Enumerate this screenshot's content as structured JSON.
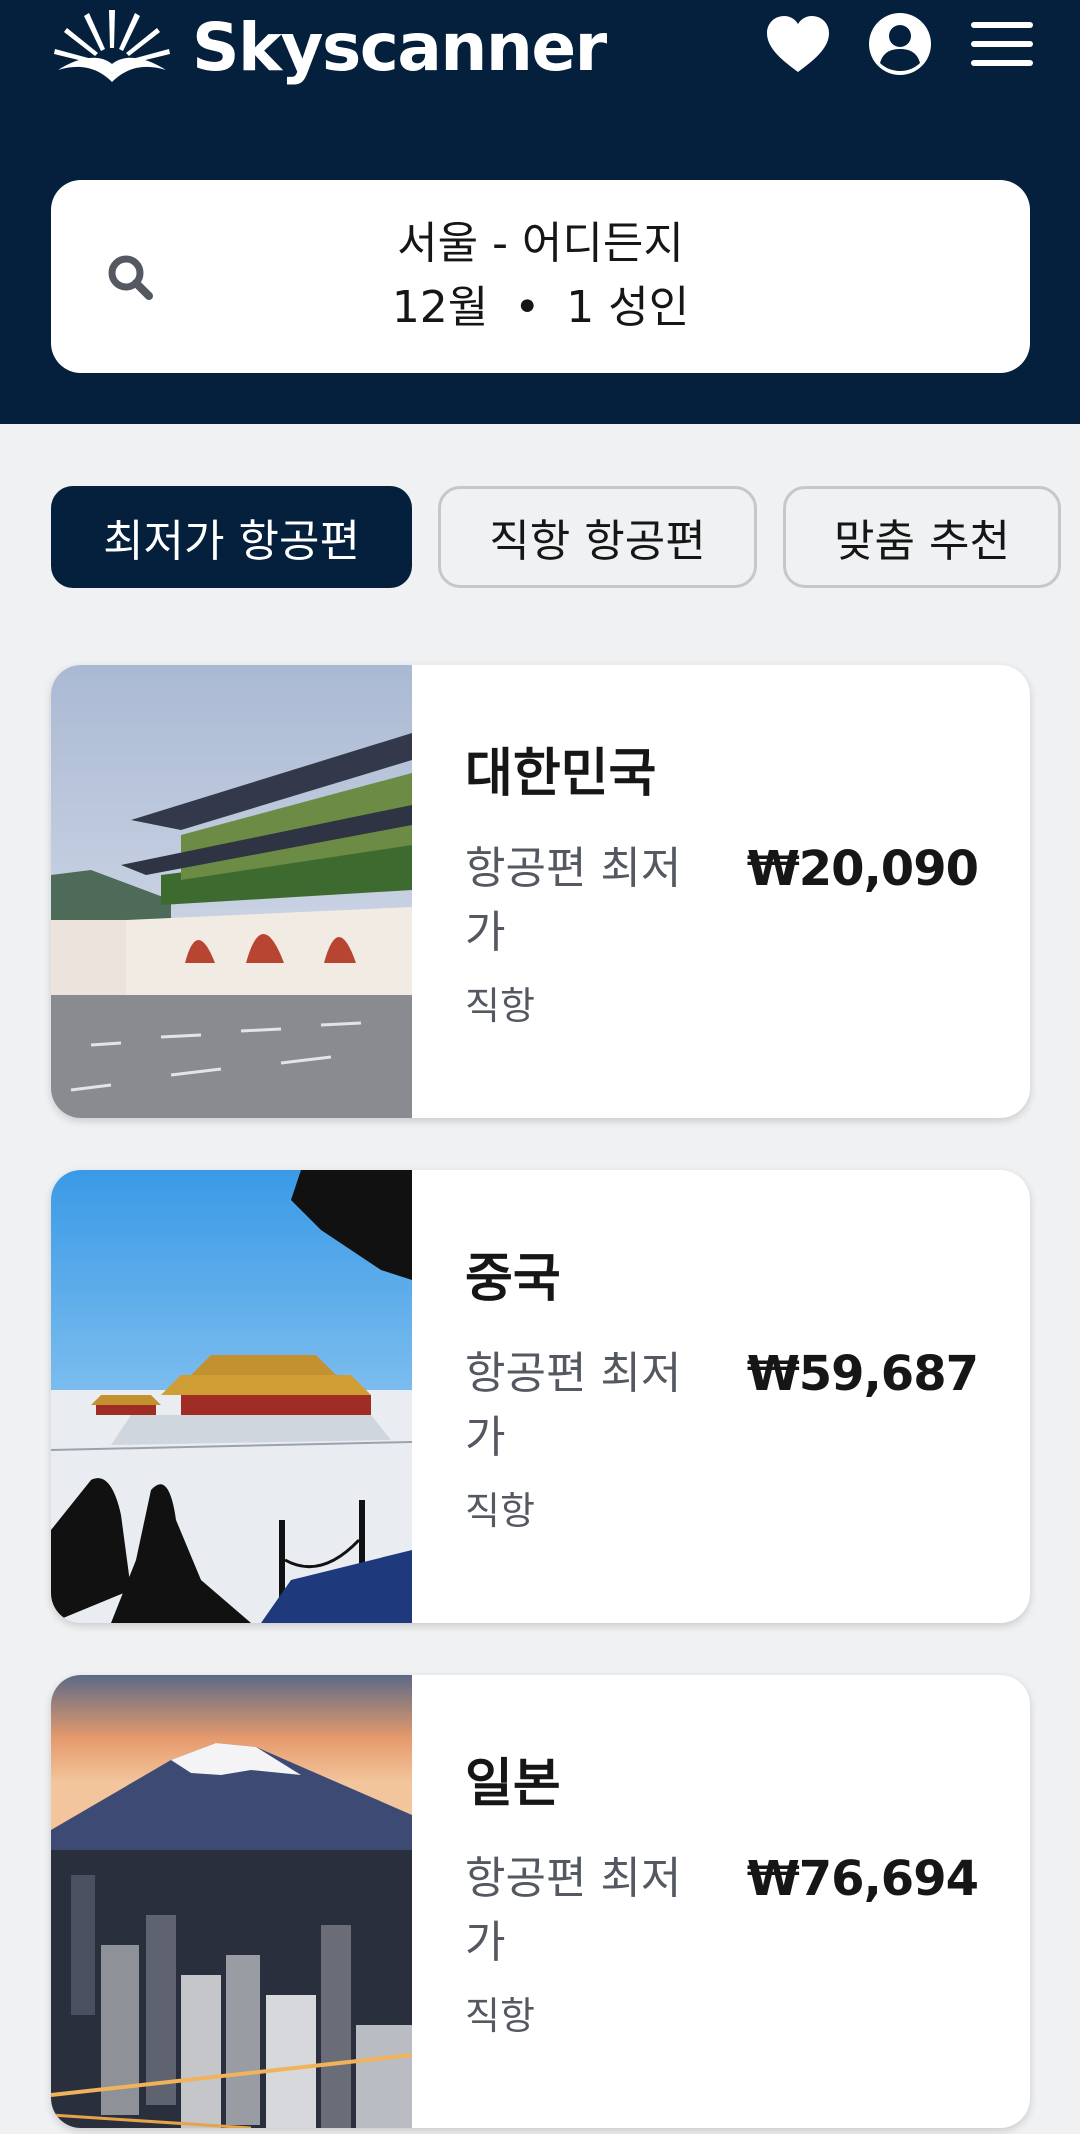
{
  "header": {
    "brand": "Skyscanner",
    "icons": [
      "heart-icon",
      "account-icon",
      "menu-icon"
    ],
    "colors": {
      "background": "#05203c",
      "text": "#ffffff"
    }
  },
  "search": {
    "route": "서울 - 어디든지",
    "month": "12월",
    "separator": "•",
    "passengers": "1 성인"
  },
  "filters": [
    {
      "label": "최저가 항공편",
      "selected": true
    },
    {
      "label": "직항 항공편",
      "selected": false
    },
    {
      "label": "맞춤 추천",
      "selected": false
    }
  ],
  "destinations": [
    {
      "country": "대한민국",
      "subtitle": "항공편 최저가",
      "flight_type": "직항",
      "price": "₩20,090"
    },
    {
      "country": "중국",
      "subtitle": "항공편 최저가",
      "flight_type": "직항",
      "price": "₩59,687"
    },
    {
      "country": "일본",
      "subtitle": "항공편 최저가",
      "flight_type": "직항",
      "price": "₩76,694"
    }
  ],
  "colors": {
    "page_background": "#eff1f3",
    "card_background": "#ffffff",
    "chip_active": "#05203c",
    "chip_border": "#c2c9cd",
    "secondary_text": "#545860"
  }
}
